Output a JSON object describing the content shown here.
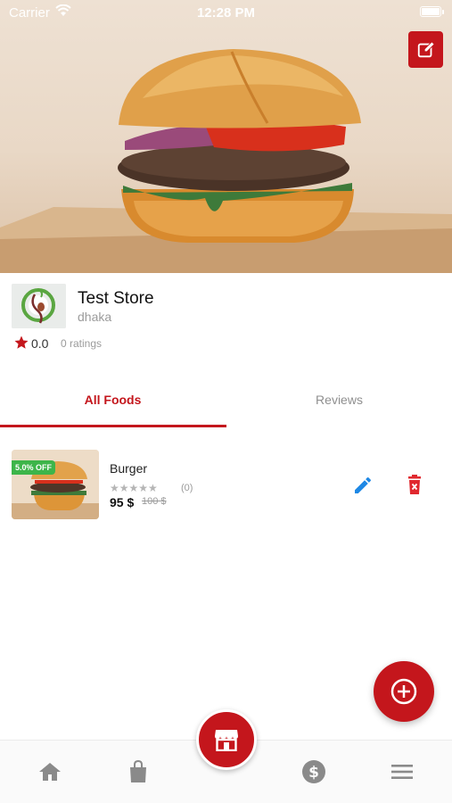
{
  "status_bar": {
    "carrier": "Carrier",
    "time": "12:28 PM"
  },
  "header": {
    "edit_icon": "edit-square-icon"
  },
  "store": {
    "name": "Test Store",
    "location": "dhaka",
    "rating": "0.0",
    "rating_count": "0 ratings",
    "rating_icon": "star-icon"
  },
  "tabs": [
    {
      "label": "All Foods",
      "active": true
    },
    {
      "label": "Reviews",
      "active": false
    }
  ],
  "foods": [
    {
      "name": "Burger",
      "discount": "5.0% OFF",
      "stars": "★★★★★",
      "rating_fraction": 0,
      "review_count": "(0)",
      "price": "95 $",
      "old_price": "100 $"
    }
  ],
  "fab": {
    "icon": "add-circle-icon"
  },
  "bottom_nav": {
    "items": [
      "home-icon",
      "shopping-bag-icon",
      "store-icon",
      "dollar-icon",
      "menu-icon"
    ]
  },
  "colors": {
    "accent": "#c4161c",
    "badge": "#3db54a",
    "edit_blue": "#1e88e5"
  }
}
